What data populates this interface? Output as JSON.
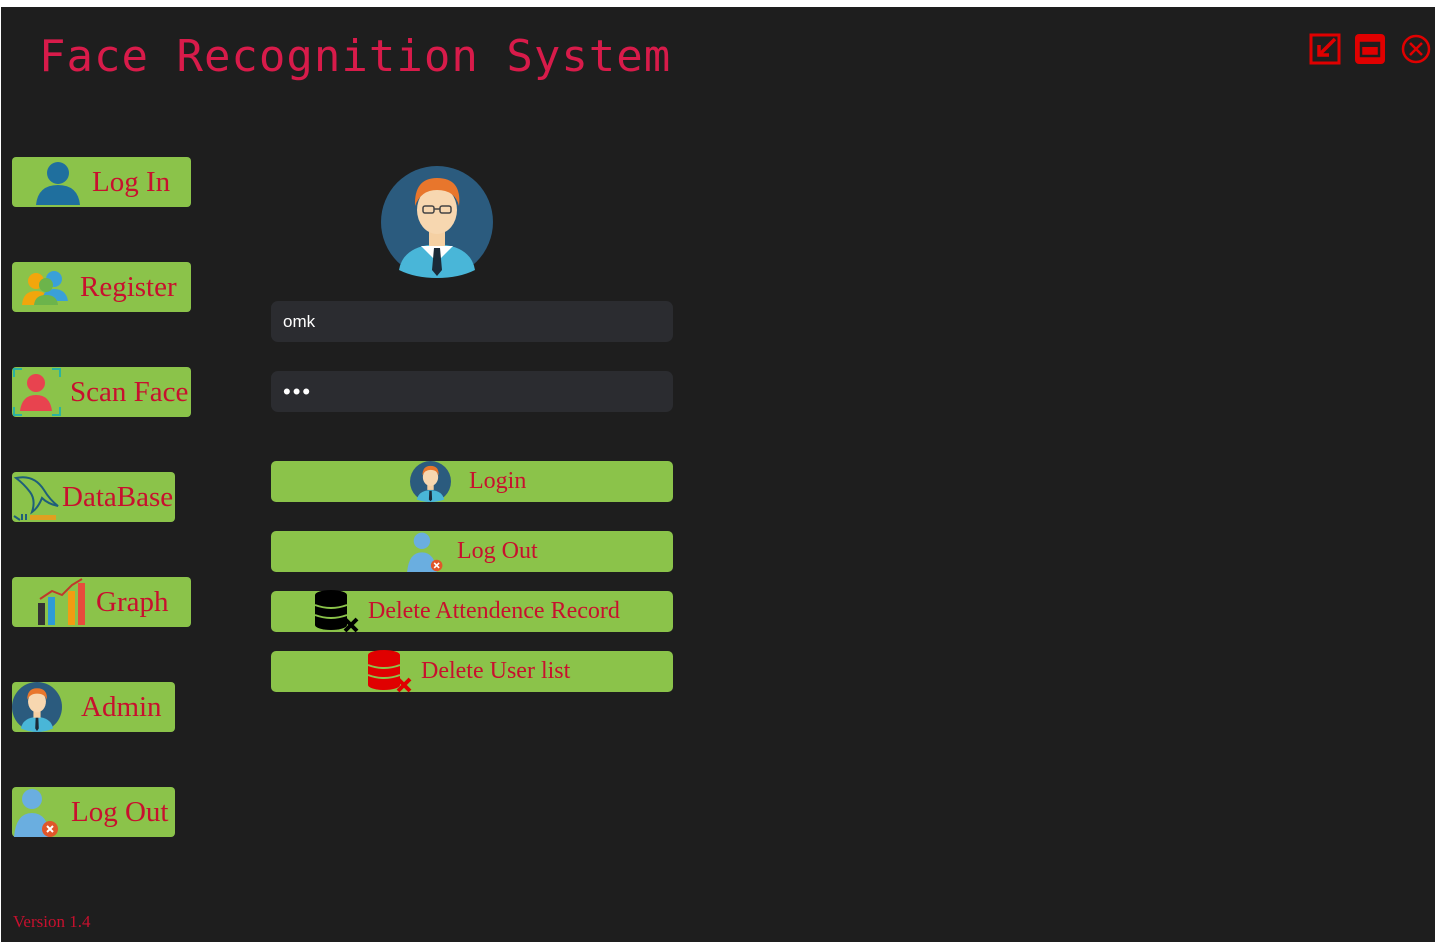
{
  "app": {
    "title": "Face Recognition System",
    "version": "Version 1.4"
  },
  "window_controls": [
    "minimize-arrow-icon",
    "maximize-icon",
    "close-icon"
  ],
  "sidebar": {
    "items": [
      {
        "label": "Log In",
        "icon": "user-icon"
      },
      {
        "label": "Register",
        "icon": "users-group-icon"
      },
      {
        "label": "Scan Face",
        "icon": "face-scan-icon"
      },
      {
        "label": "DataBase",
        "icon": "mysql-dolphin-icon"
      },
      {
        "label": "Graph",
        "icon": "bar-chart-icon"
      },
      {
        "label": "Admin",
        "icon": "admin-avatar-icon"
      },
      {
        "label": "Log Out",
        "icon": "user-logout-icon"
      }
    ]
  },
  "login_form": {
    "username_value": "omk",
    "password_value": "•••",
    "buttons": {
      "login": "Login",
      "logout": "Log Out",
      "delete_attendance": "Delete Attendence Record",
      "delete_users": "Delete User list"
    }
  },
  "colors": {
    "background": "#1e1e1e",
    "accent_green": "#8bc34a",
    "text_red": "#c8102e",
    "title_pink": "#d81b4a",
    "input_bg": "#2b2c30"
  }
}
